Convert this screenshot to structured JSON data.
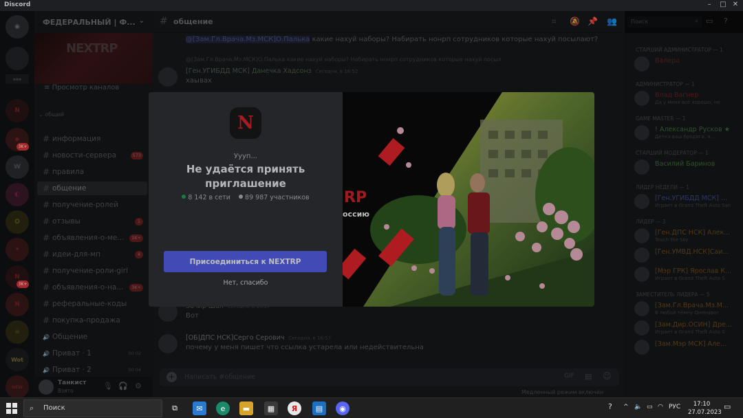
{
  "window": {
    "app_name": "Discord"
  },
  "server": {
    "name": "ФЕДЕРАЛЬНЫЙ | Ф...",
    "banner_text": "NEXTRP",
    "browse_label": "Просмотр каналов",
    "category": "общий",
    "channels": [
      {
        "name": "информация",
        "badge": ""
      },
      {
        "name": "новости-сервера",
        "badge": "573"
      },
      {
        "name": "правила",
        "badge": ""
      },
      {
        "name": "общение",
        "badge": ""
      },
      {
        "name": "получение-ролей",
        "badge": ""
      },
      {
        "name": "отзывы",
        "badge": "1"
      },
      {
        "name": "объявления-о-ме...",
        "badge": "1K+"
      },
      {
        "name": "идеи-для-мп",
        "badge": "4"
      },
      {
        "name": "получение-роли-girl",
        "badge": ""
      },
      {
        "name": "объявления-о-на...",
        "badge": "3K+"
      },
      {
        "name": "реферальные-коды",
        "badge": ""
      },
      {
        "name": "покупка-продажа",
        "badge": ""
      },
      {
        "name": "Общение",
        "badge": ""
      },
      {
        "name": "Приват · 1",
        "badge": "00  02"
      },
      {
        "name": "Приват · 2",
        "badge": "00  04"
      }
    ]
  },
  "user": {
    "name": "Танкист",
    "status": "Взято"
  },
  "chat": {
    "channel": "общение",
    "search_placeholder": "Поиск",
    "messages": [
      {
        "author": "",
        "time": "",
        "mention": "@[Зам.Гл.Врача.Мз.МСК]О.Палька",
        "text": " какие нахуй наборы? Набирать нонрп сотрудников которые нахуй посылают?"
      },
      {
        "author": "[Ген.УГИБДД МСК] Данечка Хадсонз",
        "time": "Сегодня, в 16:52",
        "mention": "",
        "text": "хаывах"
      },
      {
        "author": "Зачир Шал",
        "time": "Сегодня, в 16:57",
        "mention": "",
        "text": "Вот"
      },
      {
        "author": "[ОБ|ДПС НСК]Серго Серович",
        "time": "Сегодня, в 16:57",
        "mention": "",
        "text": "почему у меня пишет что ссылка устарела или недействительна"
      }
    ],
    "reply_preview": "@[Зам.Гл.Врача.Мз.МСК]О.Палька какие нахуй наборы? Набирать нонрп сотрудников которые нахуй посыл",
    "input_placeholder": "Написать #общение",
    "slowmode": "Медленный режим включён"
  },
  "members": {
    "groups": [
      {
        "role": "Старший администратор — 1",
        "items": [
          {
            "name": "Валера",
            "activity": "",
            "color": "#6b1f22"
          }
        ]
      },
      {
        "role": "Администратор — 1",
        "items": [
          {
            "name": "Влад Вагнер",
            "activity": "Да у меня всё хорошо, не",
            "color": "#6b1f22"
          }
        ]
      },
      {
        "role": "Game Master — 1",
        "items": [
          {
            "name": "! Александр Русков ★",
            "activity": "Детка ваш бродяга, я...",
            "color": "#3f6b3f"
          }
        ]
      },
      {
        "role": "Старший модератор — 1",
        "items": [
          {
            "name": "Василий Баринов",
            "activity": "",
            "color": "#3f6b3f"
          }
        ]
      },
      {
        "role": "Лидер недели — 1",
        "items": [
          {
            "name": "[Ген.УГИБДД МСК] ...",
            "activity": "Играет в Grand Theft Auto San",
            "color": "#3e4a8a"
          }
        ]
      },
      {
        "role": "Лидер — 3",
        "items": [
          {
            "name": "[Ген.ДПС НСК] Алек...",
            "activity": "Touch the Sky",
            "color": "#6b4a1f"
          },
          {
            "name": "[Ген.УМВД.НСК]Саи...",
            "activity": "",
            "color": "#6b4a1f"
          },
          {
            "name": "[Мэр ГРК] Ярослав К...",
            "activity": "Играет в Grand Theft Auto S",
            "color": "#6b4a1f"
          }
        ]
      },
      {
        "role": "Заместитель лидера — 5",
        "items": [
          {
            "name": "[Зам.Гл.Врача.Мз.М...",
            "activity": "В любой тёмну Оненавот",
            "color": "#6b4a1f"
          },
          {
            "name": "[Зам.Дир.ОСИН] Дре...",
            "activity": "Играет в Grand Theft Auto S",
            "color": "#6b4a1f"
          },
          {
            "name": "[Зам.Мэр МСК] Але...",
            "activity": "",
            "color": "#6b4a1f"
          }
        ]
      }
    ]
  },
  "invite": {
    "icon_letter": "N",
    "oops": "Уууп...",
    "title": "Не удаётся принять приглашение",
    "online": "8 142 в сети",
    "members": "89 987 участников",
    "join_label": "Присоединиться к NEXTRP",
    "decline_label": "Нет, спасибо",
    "art_text_1": "RP",
    "art_text_2": "оссию"
  },
  "taskbar": {
    "search_label": "Поиск",
    "lang": "РУС",
    "time": "17:10",
    "date": "27.07.2023"
  },
  "colors": {
    "accent": "#5865f2",
    "online": "#23a55a",
    "offline": "#80848e",
    "brand_red": "#e0242b"
  }
}
